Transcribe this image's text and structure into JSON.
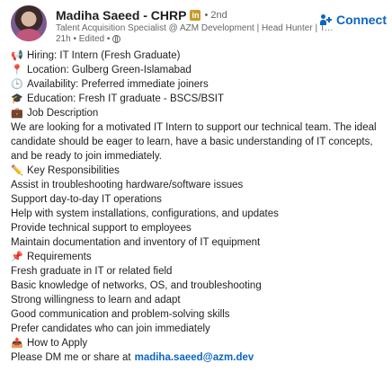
{
  "author": {
    "name": "Madiha Saeed - CHRP",
    "badge": "in",
    "degree": "• 2nd",
    "headline": "Talent Acquisition Specialist @ AZM Development | Head Hunter | Te...",
    "meta": "21h • Edited •"
  },
  "connect_label": "Connect",
  "icons": {
    "megaphone": "megaphone-icon",
    "location": "pin-icon",
    "availability": "clock-icon",
    "education": "graduation-cap-icon",
    "job": "briefcase-icon",
    "responsibilities": "pencil-icon",
    "requirements": "pushpin-icon",
    "apply": "inbox-icon"
  },
  "post": {
    "hiring": "Hiring: IT Intern (Fresh Graduate)",
    "location": "Location: Gulberg Green-Islamabad",
    "availability": "Availability: Preferred immediate joiners",
    "education": "Education: Fresh IT graduate - BSCS/BSIT",
    "job_heading": "Job Description",
    "description": "We are looking for a motivated IT Intern to support our technical team. The ideal candidate should be eager to learn, have a basic understanding of IT concepts, and be ready to join immediately.",
    "responsibilities_heading": "Key Responsibilities",
    "responsibilities": [
      "Assist in troubleshooting hardware/software issues",
      "Support day-to-day IT operations",
      "Help with system installations, configurations, and updates",
      "Provide technical support to employees",
      "Maintain documentation and inventory of IT equipment"
    ],
    "requirements_heading": "Requirements",
    "requirements": [
      "Fresh graduate in IT or related field",
      "Basic knowledge of networks, OS, and troubleshooting",
      "Strong willingness to learn and adapt",
      "Good communication and problem-solving skills",
      "Prefer candidates who can join immediately"
    ],
    "apply_heading": "How to Apply",
    "apply_text": "Please DM me or share at",
    "apply_email": "madiha.saeed@azm.dev"
  }
}
